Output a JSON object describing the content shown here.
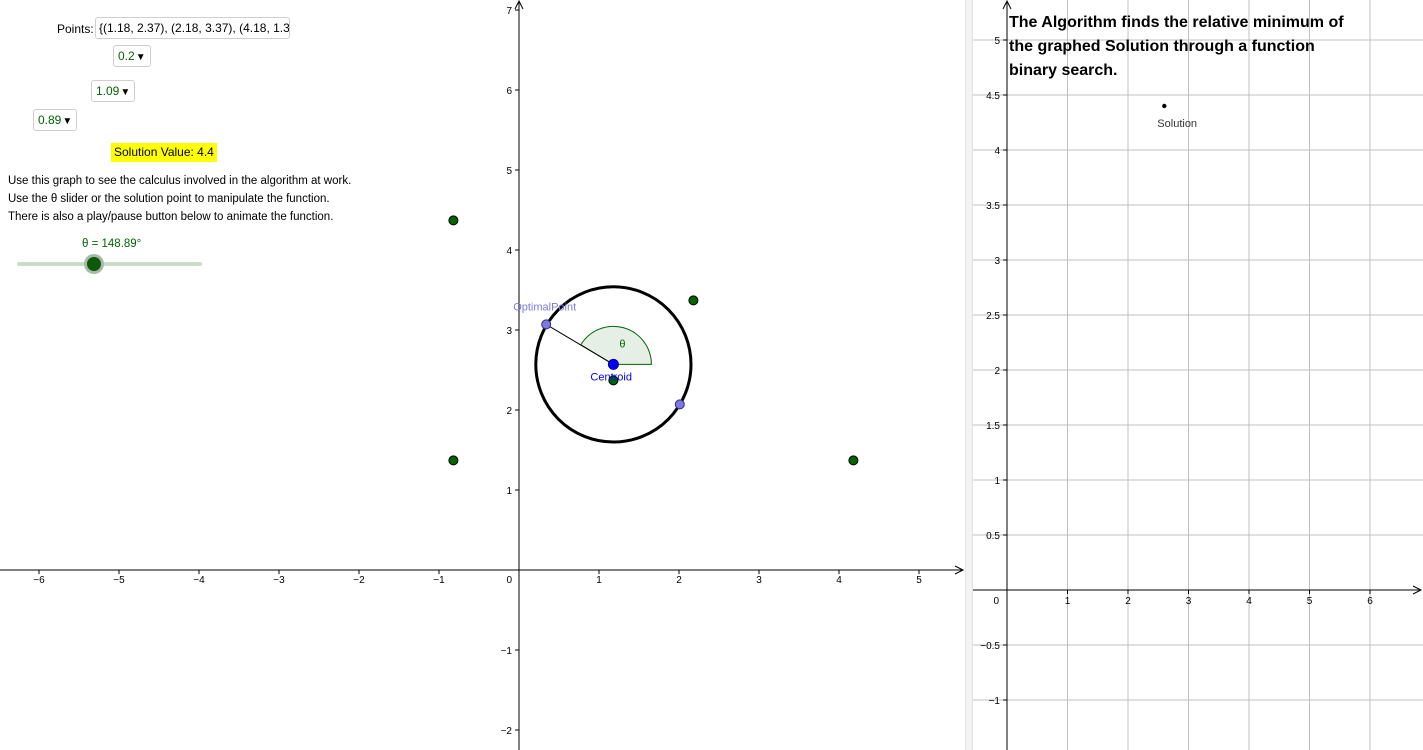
{
  "left_panel": {
    "points_label": "Points:",
    "points_value": "{(1.18, 2.37), (2.18, 3.37), (4.18, 1.3",
    "dropdown1_value": "0.2",
    "dropdown2_value": "1.09",
    "dropdown3_value": "0.89",
    "solution_value": "Solution Value: 4.4",
    "info_lines": [
      "Use this graph to see the calculus involved in the algorithm at work.",
      "Use the θ slider or the solution point to manipulate the function.",
      "There is also a play/pause button below to animate the function."
    ],
    "theta_label": "θ = 148.89°",
    "theta_degrees": 148.89
  },
  "graph1": {
    "x_ticks": [
      -6,
      -5,
      -4,
      -3,
      -2,
      -1,
      1,
      2,
      3,
      4,
      5
    ],
    "y_ticks": [
      -2,
      -1,
      1,
      2,
      3,
      4,
      5,
      6,
      7
    ],
    "origin_label": "0",
    "points": [
      {
        "x": -0.82,
        "y": 4.37
      },
      {
        "x": 2.18,
        "y": 3.37
      },
      {
        "x": 1.18,
        "y": 2.37
      },
      {
        "x": -0.82,
        "y": 1.37
      },
      {
        "x": 4.18,
        "y": 1.37
      }
    ],
    "centroid": {
      "x": 1.18,
      "y": 2.57,
      "label": "Centroid"
    },
    "optimal_point": {
      "x": 0.34,
      "y": 3.07,
      "label": "OptimalPoint"
    },
    "second_point": {
      "x": 2.01,
      "y": 2.07
    },
    "circle_radius": 0.97,
    "angle_label": "θ",
    "colors": {
      "point": "#006400",
      "centroid": "#0000ff",
      "optimal": "#7b7bde"
    }
  },
  "graph2": {
    "note": "The Algorithm finds the relative minimum of the graphed Solution through a function binary search.",
    "x_ticks": [
      1,
      2,
      3,
      4,
      5,
      6
    ],
    "y_ticks": [
      "-1",
      "-0.5",
      "0.5",
      "1",
      "1.5",
      "2",
      "2.5",
      "3",
      "3.5",
      "4",
      "4.5",
      "5"
    ],
    "origin_label": "0",
    "solution_point": {
      "x": 2.6,
      "y": 4.4,
      "label": "Solution"
    }
  }
}
